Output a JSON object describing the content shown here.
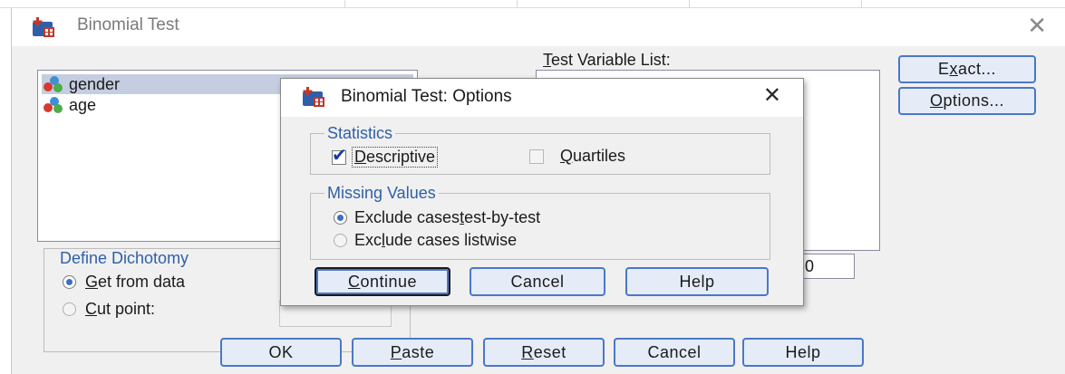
{
  "main_dialog": {
    "title": "Binomial Test",
    "variables": [
      {
        "name": "gender",
        "selected": true
      },
      {
        "name": "age",
        "selected": false
      }
    ],
    "test_list_label_pre": "",
    "test_list_label_ul": "T",
    "test_list_label_post": "est Variable List:",
    "exact_button": {
      "pre": "E",
      "ul": "x",
      "post": "act..."
    },
    "options_button": {
      "pre": "",
      "ul": "O",
      "post": "ptions..."
    },
    "define_dichotomy": {
      "legend": "Define Dichotomy",
      "get_from_data": {
        "ul": "G",
        "post": "et from data",
        "selected": true
      },
      "cut_point": {
        "ul": "C",
        "post": "ut point:",
        "selected": false
      }
    },
    "hidden_value_fragment": "0",
    "buttons": {
      "ok": "OK",
      "paste": {
        "ul": "P",
        "post": "aste"
      },
      "reset": {
        "ul": "R",
        "post": "eset"
      },
      "cancel": "Cancel",
      "help": "Help"
    }
  },
  "options_dialog": {
    "title": "Binomial Test: Options",
    "statistics": {
      "legend": "Statistics",
      "descriptive": {
        "ul": "D",
        "post": "escriptive",
        "checked": true
      },
      "quartiles": {
        "ul": "Q",
        "post": "uartiles",
        "checked": false
      }
    },
    "missing_values": {
      "legend": "Missing Values",
      "test_by_test": {
        "pre": "Exclude cases ",
        "ul": "t",
        "post": "est-by-test",
        "selected": true
      },
      "listwise": {
        "pre": "Exc",
        "ul": "l",
        "post": "ude cases listwise",
        "selected": false
      }
    },
    "buttons": {
      "continue": {
        "ul": "C",
        "post": "ontinue"
      },
      "cancel": "Cancel",
      "help": "Help"
    }
  },
  "colors": {
    "accent": "#4a78c8",
    "group_legend": "#3060a8",
    "selection": "#c5cee0"
  }
}
